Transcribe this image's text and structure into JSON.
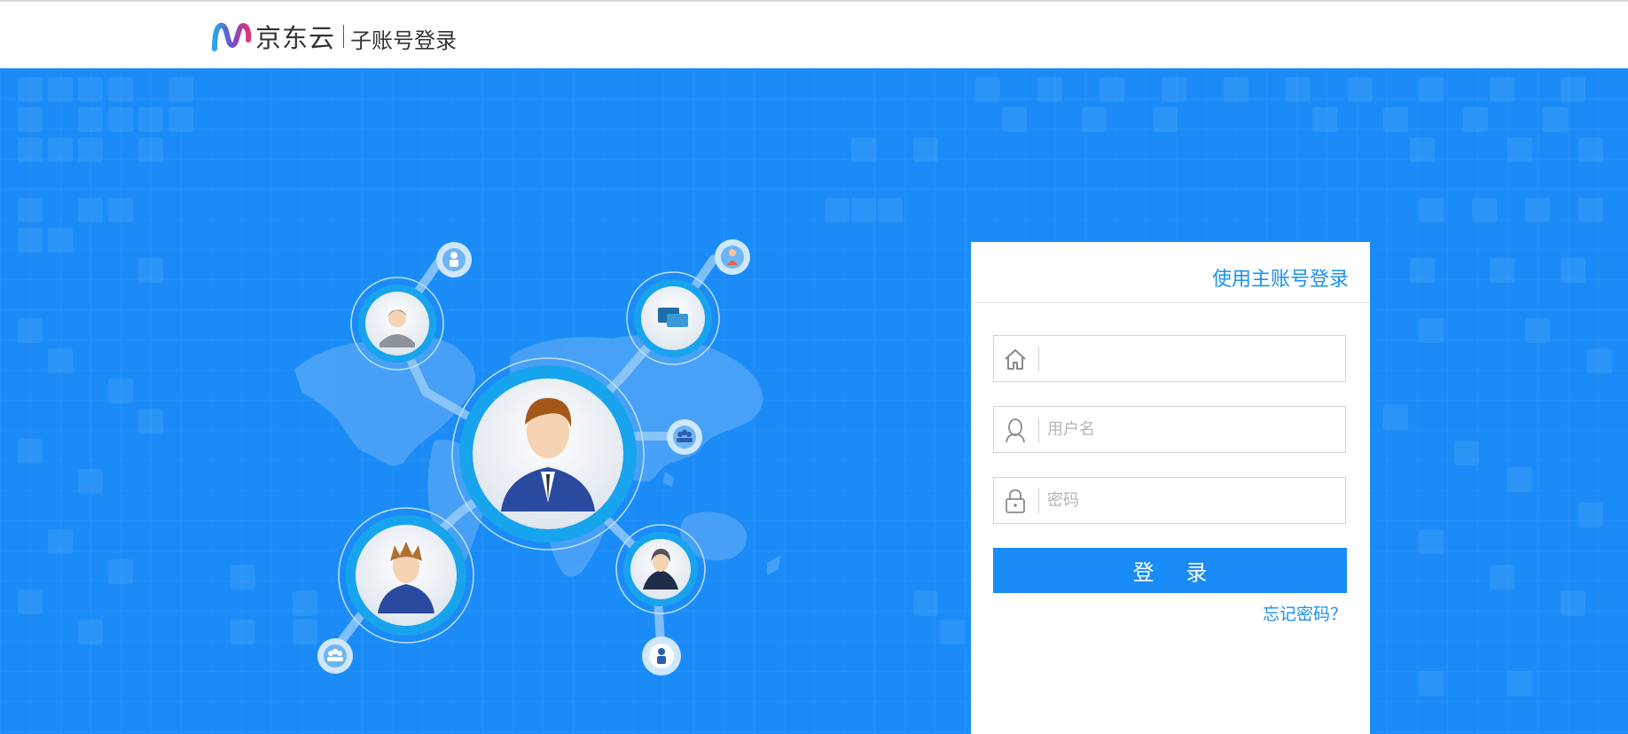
{
  "header": {
    "brand_name": "京东云",
    "sub_title": "子账号登录"
  },
  "login": {
    "main_account_link": "使用主账号登录",
    "domain_field": {
      "value": "",
      "placeholder": "",
      "icon": "home-icon"
    },
    "username_field": {
      "value": "",
      "placeholder": "用户名",
      "icon": "user-icon"
    },
    "password_field": {
      "value": "",
      "placeholder": "密码",
      "icon": "lock-icon"
    },
    "submit_label": "登 录",
    "forgot_password": "忘记密码？"
  },
  "colors": {
    "banner_blue": "#1b8cf7",
    "link_blue": "#1a90f0",
    "button_blue": "#1a8cf7",
    "card_bg": "#ffffff"
  },
  "hero_illustration": {
    "nodes": [
      "center-businessman",
      "man-grey-suit",
      "chat-bubbles",
      "spiky-hair-man",
      "woman-dark-suit"
    ],
    "satellites": [
      "person",
      "woman-red",
      "group",
      "group",
      "person"
    ]
  }
}
